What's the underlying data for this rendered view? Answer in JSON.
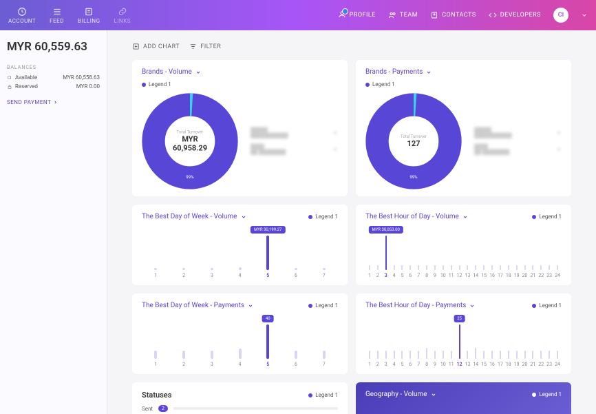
{
  "header": {
    "tabs": [
      {
        "label": "ACCOUNT"
      },
      {
        "label": "FEED"
      },
      {
        "label": "BILLING"
      },
      {
        "label": "LINKS"
      }
    ],
    "links": [
      {
        "label": "PROFILE"
      },
      {
        "label": "TEAM"
      },
      {
        "label": "CONTACTS"
      },
      {
        "label": "DEVELOPERS"
      }
    ],
    "avatar": "CI"
  },
  "sidebar": {
    "balance_total": "MYR 60,559.63",
    "section_label": "BALANCES",
    "rows": [
      {
        "label": "Available",
        "value": "MYR 60,558.63"
      },
      {
        "label": "Reserved",
        "value": "MYR 0.00"
      }
    ],
    "send_payment": "SEND PAYMENT"
  },
  "toolbar": {
    "add_chart": "ADD CHART",
    "filter": "FILTER"
  },
  "legend_label": "Legend 1",
  "cards": {
    "brands_volume": {
      "title": "Brands - Volume",
      "center_label": "Total Turnover",
      "center_value": "MYR 60,958.29",
      "pct": "99%"
    },
    "brands_payments": {
      "title": "Brands - Payments",
      "center_label": "Total Turnover",
      "center_value": "127",
      "pct": "99%"
    },
    "week_volume": {
      "title": "The Best Day of Week - Volume",
      "tooltip": "MYR 30,199.27"
    },
    "hour_volume": {
      "title": "The Best Hour of Day - Volume",
      "tooltip": "MYR 30,053.00"
    },
    "week_payments": {
      "title": "The Best Day of Week - Payments",
      "tooltip": "40"
    },
    "hour_payments": {
      "title": "The Best Hour of Day - Payments",
      "tooltip": "25"
    },
    "statuses": {
      "title": "Statuses",
      "sent_label": "Sent",
      "sent_count": "2"
    },
    "geography": {
      "title": "Geography - Volume"
    }
  },
  "chart_data": [
    {
      "type": "pie",
      "title": "Brands - Volume",
      "series": [
        {
          "name": "Legend 1",
          "values": [
            99,
            1
          ]
        }
      ],
      "total": "MYR 60,958.29"
    },
    {
      "type": "pie",
      "title": "Brands - Payments",
      "series": [
        {
          "name": "Legend 1",
          "values": [
            99,
            1
          ]
        }
      ],
      "total": 127
    },
    {
      "type": "bar",
      "title": "The Best Day of Week - Volume",
      "categories": [
        "1",
        "2",
        "3",
        "4",
        "5",
        "6",
        "7"
      ],
      "values": [
        1500,
        1500,
        1500,
        2500,
        30199.27,
        1500,
        1500
      ],
      "highlight_index": 4,
      "highlight_value": "MYR 30,199.27"
    },
    {
      "type": "bar",
      "title": "The Best Hour of Day - Volume",
      "categories": [
        "1",
        "2",
        "3",
        "4",
        "5",
        "6",
        "7",
        "8",
        "9",
        "10",
        "11",
        "12",
        "13",
        "14",
        "15",
        "16",
        "17",
        "18",
        "19",
        "20",
        "21",
        "22",
        "23",
        "24"
      ],
      "values": [
        4000,
        4000,
        30053,
        4000,
        4000,
        4000,
        4000,
        4000,
        4000,
        4000,
        4000,
        4000,
        4000,
        4000,
        4000,
        4000,
        4000,
        4000,
        4000,
        4000,
        4000,
        4000,
        4000,
        4000
      ],
      "highlight_index": 2,
      "highlight_value": "MYR 30,053.00"
    },
    {
      "type": "bar",
      "title": "The Best Day of Week - Payments",
      "categories": [
        "1",
        "2",
        "3",
        "4",
        "5",
        "6",
        "7"
      ],
      "values": [
        10,
        10,
        10,
        12,
        40,
        10,
        10
      ],
      "highlight_index": 4,
      "highlight_value": 40
    },
    {
      "type": "bar",
      "title": "The Best Hour of Day - Payments",
      "categories": [
        "1",
        "2",
        "3",
        "4",
        "5",
        "6",
        "7",
        "8",
        "9",
        "10",
        "11",
        "12",
        "13",
        "14",
        "15",
        "16",
        "17",
        "18",
        "19",
        "20",
        "21",
        "22",
        "23",
        "24"
      ],
      "values": [
        6,
        6,
        6,
        6,
        6,
        6,
        6,
        8,
        6,
        6,
        6,
        25,
        6,
        8,
        6,
        6,
        6,
        6,
        6,
        6,
        6,
        6,
        6,
        6
      ],
      "highlight_index": 11,
      "highlight_value": 25
    }
  ]
}
